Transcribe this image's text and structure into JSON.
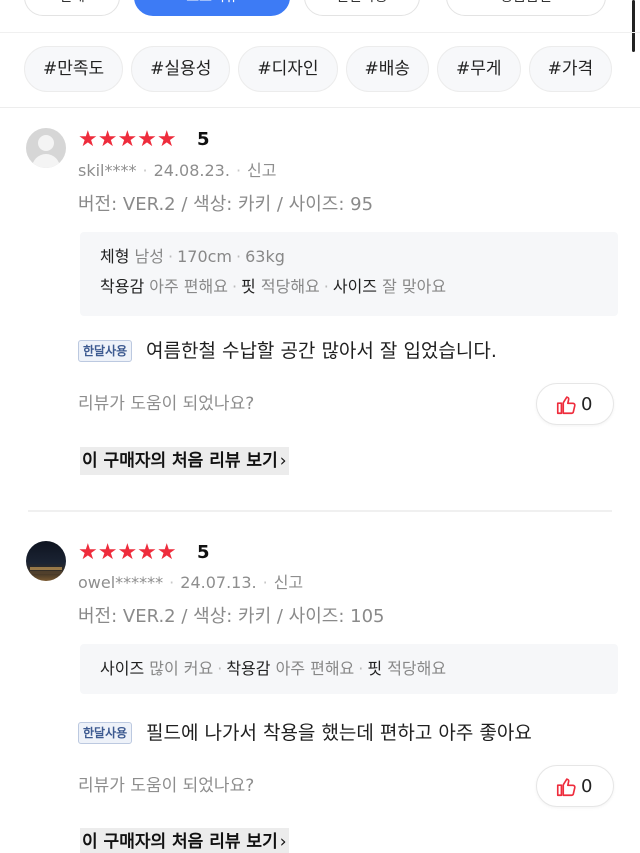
{
  "top_buttons": [
    {
      "label": "전체",
      "active": false
    },
    {
      "label": "포토리뷰",
      "active": true
    },
    {
      "label": "한달사용",
      "active": false
    },
    {
      "label": "상품옵션",
      "active": false
    }
  ],
  "chips": [
    "#만족도",
    "#실용성",
    "#디자인",
    "#배송",
    "#무게",
    "#가격"
  ],
  "reviews": [
    {
      "stars": "★★★★★",
      "score": "5",
      "user": "skil****",
      "date": "24.08.23.",
      "report": "신고",
      "option": "버전: VER.2 / 색상: 카키 / 사이즈: 95",
      "body_info": {
        "k1": "체형",
        "v1": "남성",
        "v2": "170cm",
        "v3": "63kg"
      },
      "fit_info": {
        "k1": "착용감",
        "v1": "아주 편해요",
        "k2": "핏",
        "v2": "적당해요",
        "k3": "사이즈",
        "v3": "잘 맞아요"
      },
      "badge": "한달사용",
      "content": "여름한철 수납할 공간 많아서 잘 입었습니다.",
      "helpful": "리뷰가 도움이 되었나요?",
      "likes": "0",
      "first_review": "이 구매자의 처음 리뷰 보기",
      "first_review_arrow": "›"
    },
    {
      "stars": "★★★★★",
      "score": "5",
      "user": "owel******",
      "date": "24.07.13.",
      "report": "신고",
      "option": "버전: VER.2 / 색상: 카키 / 사이즈: 105",
      "fit_info": {
        "k1": "사이즈",
        "v1": "많이 커요",
        "k2": "착용감",
        "v2": "아주 편해요",
        "k3": "핏",
        "v3": "적당해요"
      },
      "badge": "한달사용",
      "content": "필드에 나가서 착용을 했는데 편하고 아주 좋아요",
      "helpful": "리뷰가 도움이 되었나요?",
      "likes": "0",
      "first_review": "이 구매자의 처음 리뷰 보기",
      "first_review_arrow": "›"
    }
  ]
}
